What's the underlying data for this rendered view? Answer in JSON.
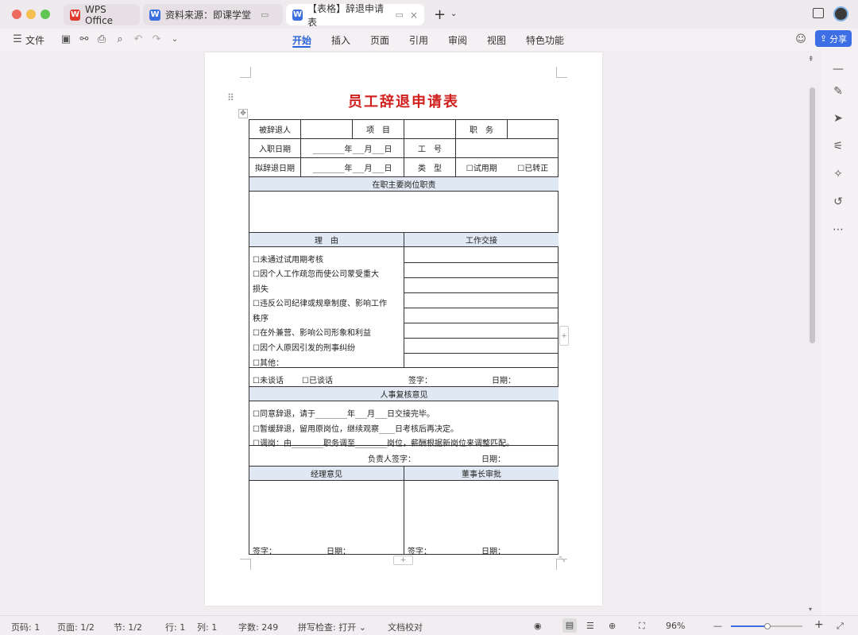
{
  "tabs": [
    {
      "label": "WPS Office"
    },
    {
      "label": "资料来源：即课学堂"
    },
    {
      "label": "【表格】辞退申请表"
    }
  ],
  "toolbar": {
    "file_label": "文件"
  },
  "menu": [
    "开始",
    "插入",
    "页面",
    "引用",
    "审阅",
    "视图",
    "特色功能"
  ],
  "share_label": "分享",
  "doc": {
    "title": "员工辞退申请表",
    "r1": {
      "a": "被辞退人",
      "b": "项　目",
      "c": "职　务"
    },
    "r2": {
      "a": "入职日期",
      "b": "________年___月___日",
      "c": "工　号"
    },
    "r3": {
      "a": "拟辞退日期",
      "b": "________年___月___日",
      "c": "类　型",
      "d": "☐试用期",
      "e": "☐已转正"
    },
    "duty": "在职主要岗位职责",
    "reason_h": "理　由",
    "handover_h": "工作交接",
    "reasons": [
      "☐未通过试用期考核",
      "☐因个人工作疏忽而使公司蒙受重大",
      "损失",
      "☐违反公司纪律或规章制度、影响工作",
      "秩序",
      "☐在外兼营、影响公司形象和利益",
      "☐因个人原因引发的刑事纠纷",
      "☐其他：______________________________"
    ],
    "talk": {
      "a": "☐未谈话",
      "b": "☐已谈话",
      "sign": "签字：",
      "date": "日期："
    },
    "hr_h": "人事复核意见",
    "hr": [
      "☐同意辞退，请于________年___月___日交接完毕。",
      "☐暂缓辞退，留用原岗位，继续观察____日考核后再决定。",
      "☐调岗：由________职务调至________岗位，薪酬根据新岗位来调整匹配。"
    ],
    "resp": {
      "sign": "负责人签字：",
      "date": "日期："
    },
    "mgr_h": "经理意见",
    "boss_h": "董事长审批",
    "mgr": {
      "sign": "签字：",
      "date": "日期："
    },
    "boss": {
      "sign": "签字：",
      "date": "日期："
    }
  },
  "status": {
    "page": "页码: 1",
    "pages": "页面: 1/2",
    "section": "节: 1/2",
    "row": "行: 1",
    "col": "列: 1",
    "words": "字数: 249",
    "spell": "拼写检查: 打开 ⌄",
    "proof": "文档校对",
    "zoom": "96%"
  }
}
